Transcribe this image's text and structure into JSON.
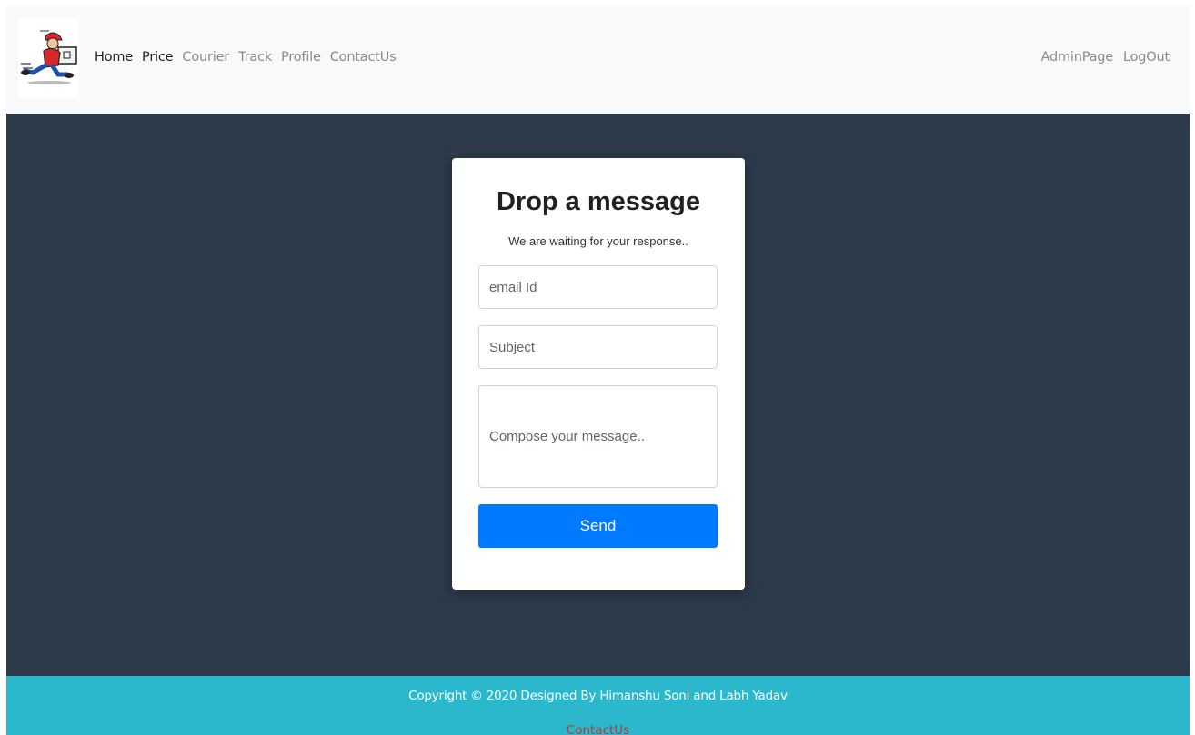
{
  "navbar": {
    "logo_icon": "courier-man-with-box-icon",
    "left_links": [
      {
        "label": "Home",
        "active": true
      },
      {
        "label": "Price",
        "active": true
      },
      {
        "label": "Courier",
        "active": false
      },
      {
        "label": "Track",
        "active": false
      },
      {
        "label": "Profile",
        "active": false
      },
      {
        "label": "ContactUs",
        "active": false
      }
    ],
    "right_links": [
      {
        "label": "AdminPage"
      },
      {
        "label": "LogOut"
      }
    ]
  },
  "contact_form": {
    "title": "Drop a message",
    "subtitle": "We are waiting for your response..",
    "email_placeholder": "email Id",
    "subject_placeholder": "Subject",
    "message_placeholder": "Compose your message..",
    "send_label": "Send"
  },
  "footer": {
    "copyright": "Copyright © 2020 Designed By Himanshu Soni and Labh Yadav",
    "link": "ContactUs"
  },
  "colors": {
    "navbar_bg": "#f8f9fa",
    "main_bg": "#2c3a4a",
    "primary_button": "#007bff",
    "footer_bg": "#2bb8cc",
    "footer_link": "#b23a3a"
  }
}
